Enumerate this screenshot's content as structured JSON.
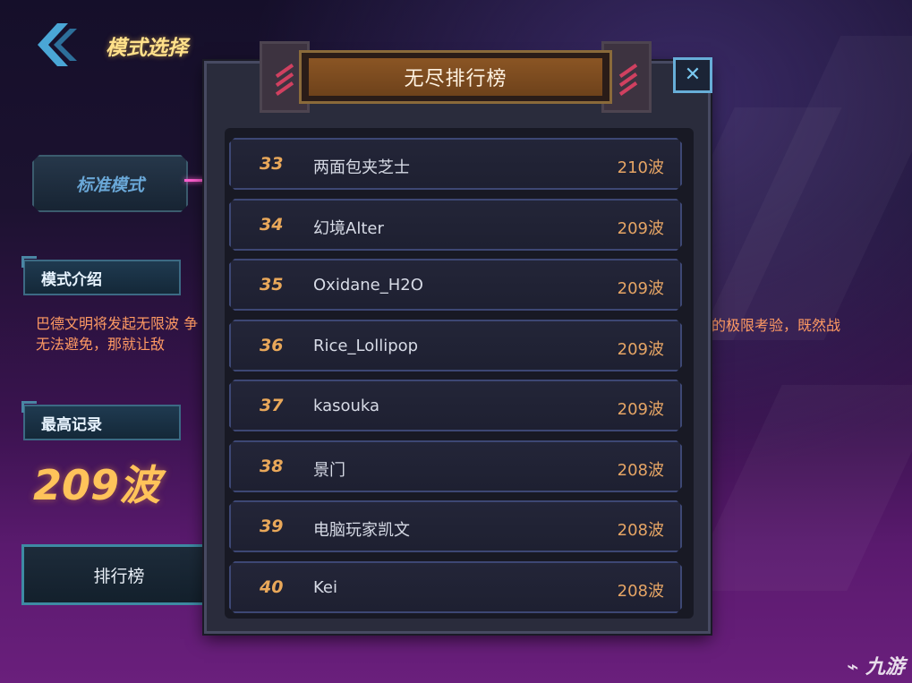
{
  "header": {
    "title": "模式选择"
  },
  "mode_tab": {
    "label": "标准模式"
  },
  "intro": {
    "heading": "模式介绍",
    "text_left": "巴德文明将发起无限波 争无法避免，那就让敌",
    "text_right": "的极限考验，既然战"
  },
  "best": {
    "heading": "最高记录",
    "value": "209波"
  },
  "ranking_button": {
    "label": "排行榜"
  },
  "modal": {
    "title": "无尽排行榜",
    "close_glyph": "✕",
    "rows": [
      {
        "rank": "33",
        "name": "两面包夹芝士",
        "score": "210波"
      },
      {
        "rank": "34",
        "name": "幻境Alter",
        "score": "209波"
      },
      {
        "rank": "35",
        "name": "Oxidane_H2O",
        "score": "209波"
      },
      {
        "rank": "36",
        "name": "Rice_Lollipop",
        "score": "209波"
      },
      {
        "rank": "37",
        "name": "kasouka",
        "score": "209波"
      },
      {
        "rank": "38",
        "name": "景门",
        "score": "208波"
      },
      {
        "rank": "39",
        "name": "电脑玩家凯文",
        "score": "208波"
      },
      {
        "rank": "40",
        "name": "Kei",
        "score": "208波"
      }
    ]
  },
  "watermark": {
    "text": "九游"
  },
  "colors": {
    "accent_gold": "#ffc35a",
    "accent_cyan": "#67aed8",
    "rank_orange": "#e9a85a"
  }
}
